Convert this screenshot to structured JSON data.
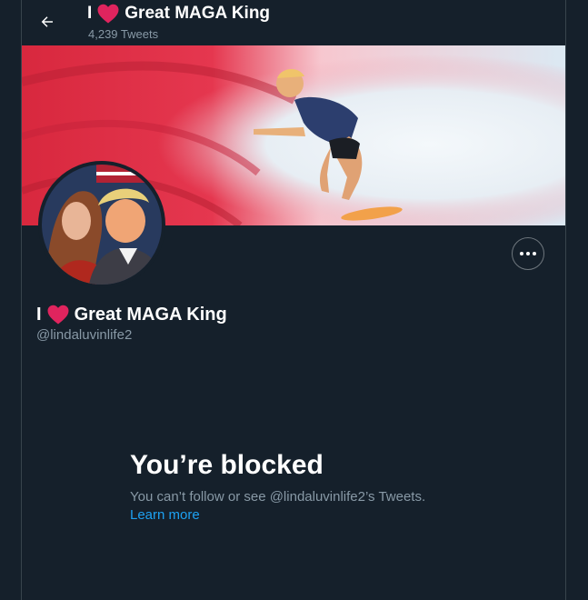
{
  "header": {
    "name_prefix": "I",
    "name_suffix": "Great MAGA King",
    "tweet_count": "4,239 Tweets"
  },
  "profile": {
    "name_prefix": "I",
    "name_suffix": "Great MAGA King",
    "handle": "@lindaluvinlife2"
  },
  "blocked": {
    "title": "You’re blocked",
    "message": "You can’t follow or see @lindaluvinlife2’s Tweets.",
    "learn_more": "Learn more"
  },
  "colors": {
    "background": "#15202b",
    "link": "#1da1f2",
    "secondary_text": "#8899a6",
    "heart": "#e0245e"
  },
  "icons": {
    "back": "back-arrow-icon",
    "heart": "heart-icon",
    "more": "more-horizontal-icon"
  }
}
